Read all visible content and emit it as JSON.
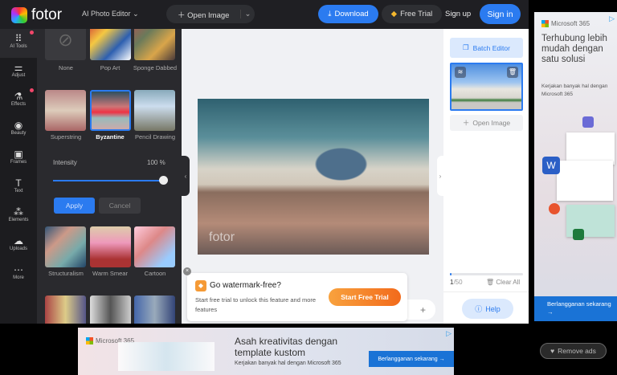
{
  "header": {
    "brand": "fotor",
    "editor_menu": "AI Photo Editor",
    "open_image": "Open Image",
    "download": "Download",
    "free_trial": "Free Trial",
    "sign_up": "Sign up",
    "sign_in": "Sign in"
  },
  "rail": [
    {
      "label": "AI Tools",
      "icon": "grid-icon"
    },
    {
      "label": "Adjust",
      "icon": "sliders-icon"
    },
    {
      "label": "Effects",
      "icon": "flask-icon"
    },
    {
      "label": "Beauty",
      "icon": "eye-icon"
    },
    {
      "label": "Frames",
      "icon": "frame-icon"
    },
    {
      "label": "Text",
      "icon": "text-icon"
    },
    {
      "label": "Elements",
      "icon": "shapes-icon"
    },
    {
      "label": "Uploads",
      "icon": "cloud-upload-icon"
    },
    {
      "label": "More",
      "icon": "more-icon"
    }
  ],
  "effects": [
    {
      "label": "None"
    },
    {
      "label": "Pop Art"
    },
    {
      "label": "Sponge Dabbed"
    },
    {
      "label": "Superstring"
    },
    {
      "label": "Byzantine",
      "selected": true
    },
    {
      "label": "Pencil Drawing"
    },
    {
      "label": "Structuralism"
    },
    {
      "label": "Warm Smear"
    },
    {
      "label": "Cartoon"
    }
  ],
  "intensity": {
    "label": "Intensity",
    "value": 100,
    "display": "100 %"
  },
  "actions": {
    "apply": "Apply",
    "cancel": "Cancel"
  },
  "canvas": {
    "watermark": "fotor"
  },
  "popup": {
    "title": "Go watermark-free?",
    "desc": "Start free trial to unlock this feature and more features",
    "cta": "Start Free Trial"
  },
  "right": {
    "batch_editor": "Batch Editor",
    "open_image": "Open Image",
    "count_current": "1",
    "count_total": "/50",
    "clear_all": "Clear All",
    "help": "Help",
    "progress": 0.02
  },
  "ad_side": {
    "brand": "Microsoft 365",
    "headline": "Terhubung lebih mudah dengan satu solusi",
    "sub": "Kerjakan banyak hal dengan Microsoft 365",
    "cta": "Berlangganan sekarang →"
  },
  "ad_bottom": {
    "brand": "Microsoft 365",
    "headline": "Asah kreativitas dengan template kustom",
    "sub": "Kerjakan banyak hal dengan Microsoft 365",
    "cta": "Berlangganan sekarang →"
  },
  "remove_ads": "Remove ads",
  "colors": {
    "accent": "#2b7bf0",
    "dark": "#1f1f23",
    "orange": "#f26a1b"
  }
}
